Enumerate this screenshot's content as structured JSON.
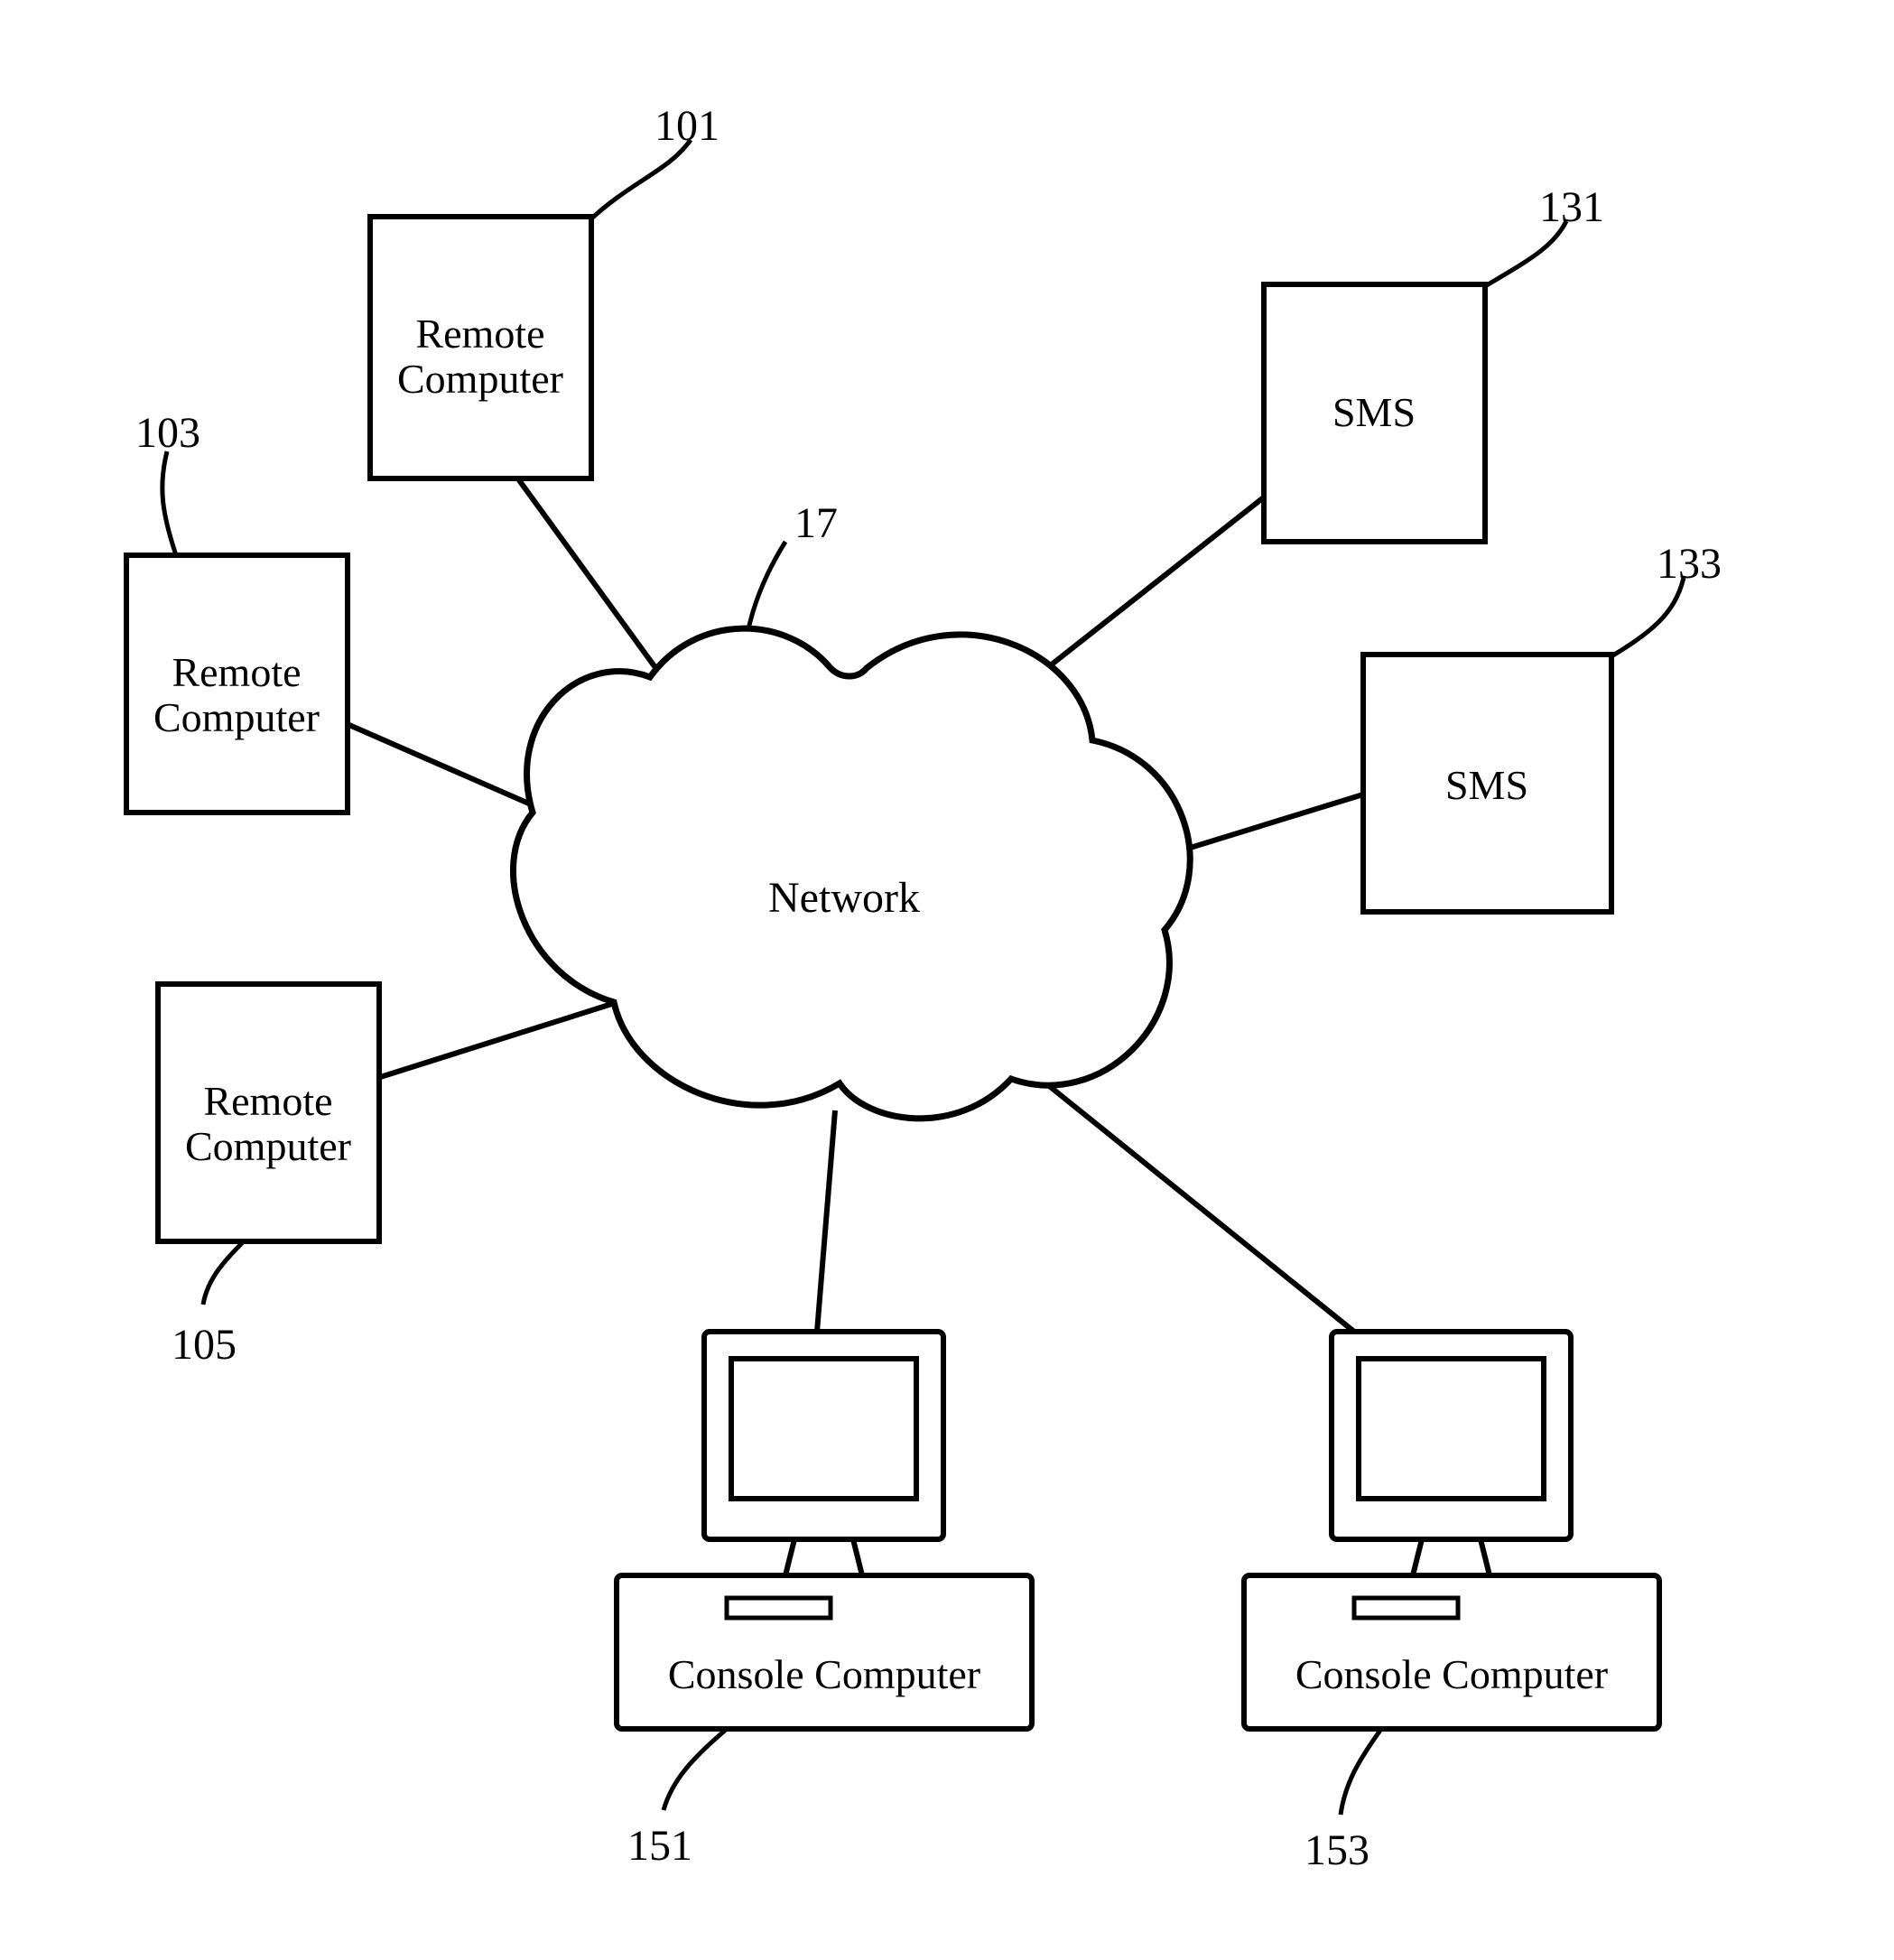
{
  "network": {
    "label": "Network",
    "ref": "17"
  },
  "remoteComputers": [
    {
      "label1": "Remote",
      "label2": "Computer",
      "ref": "101"
    },
    {
      "label1": "Remote",
      "label2": "Computer",
      "ref": "103"
    },
    {
      "label1": "Remote",
      "label2": "Computer",
      "ref": "105"
    }
  ],
  "sms": [
    {
      "label": "SMS",
      "ref": "131"
    },
    {
      "label": "SMS",
      "ref": "133"
    }
  ],
  "consoles": [
    {
      "label": "Console Computer",
      "ref": "151"
    },
    {
      "label": "Console Computer",
      "ref": "153"
    }
  ]
}
